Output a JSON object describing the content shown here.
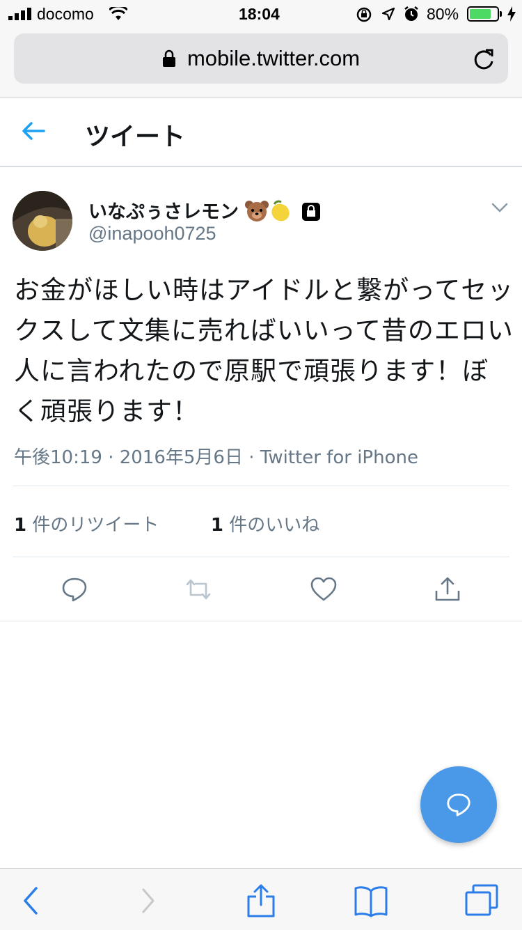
{
  "status_bar": {
    "carrier": "docomo",
    "time": "18:04",
    "battery_percent": "80%",
    "battery_level": 0.8
  },
  "browser": {
    "url": "mobile.twitter.com"
  },
  "header": {
    "title": "ツイート"
  },
  "tweet": {
    "display_name": "いなぷぅさレモン",
    "handle": "@inapooh0725",
    "text": "お金がほしい時はアイドルと繋がってセックスして文集に売ればいいって昔のエロい人に言われたので原駅で頑張ります！ぼく頑張ります！",
    "meta": "午後10:19 · 2016年5月6日 · Twitter for iPhone",
    "retweet_count": "1",
    "retweet_label": " 件のリツイート",
    "like_count": "1",
    "like_label": " 件のいいね"
  },
  "colors": {
    "accent": "#1da1f2",
    "fab": "#4a99e9",
    "muted": "#657786"
  }
}
